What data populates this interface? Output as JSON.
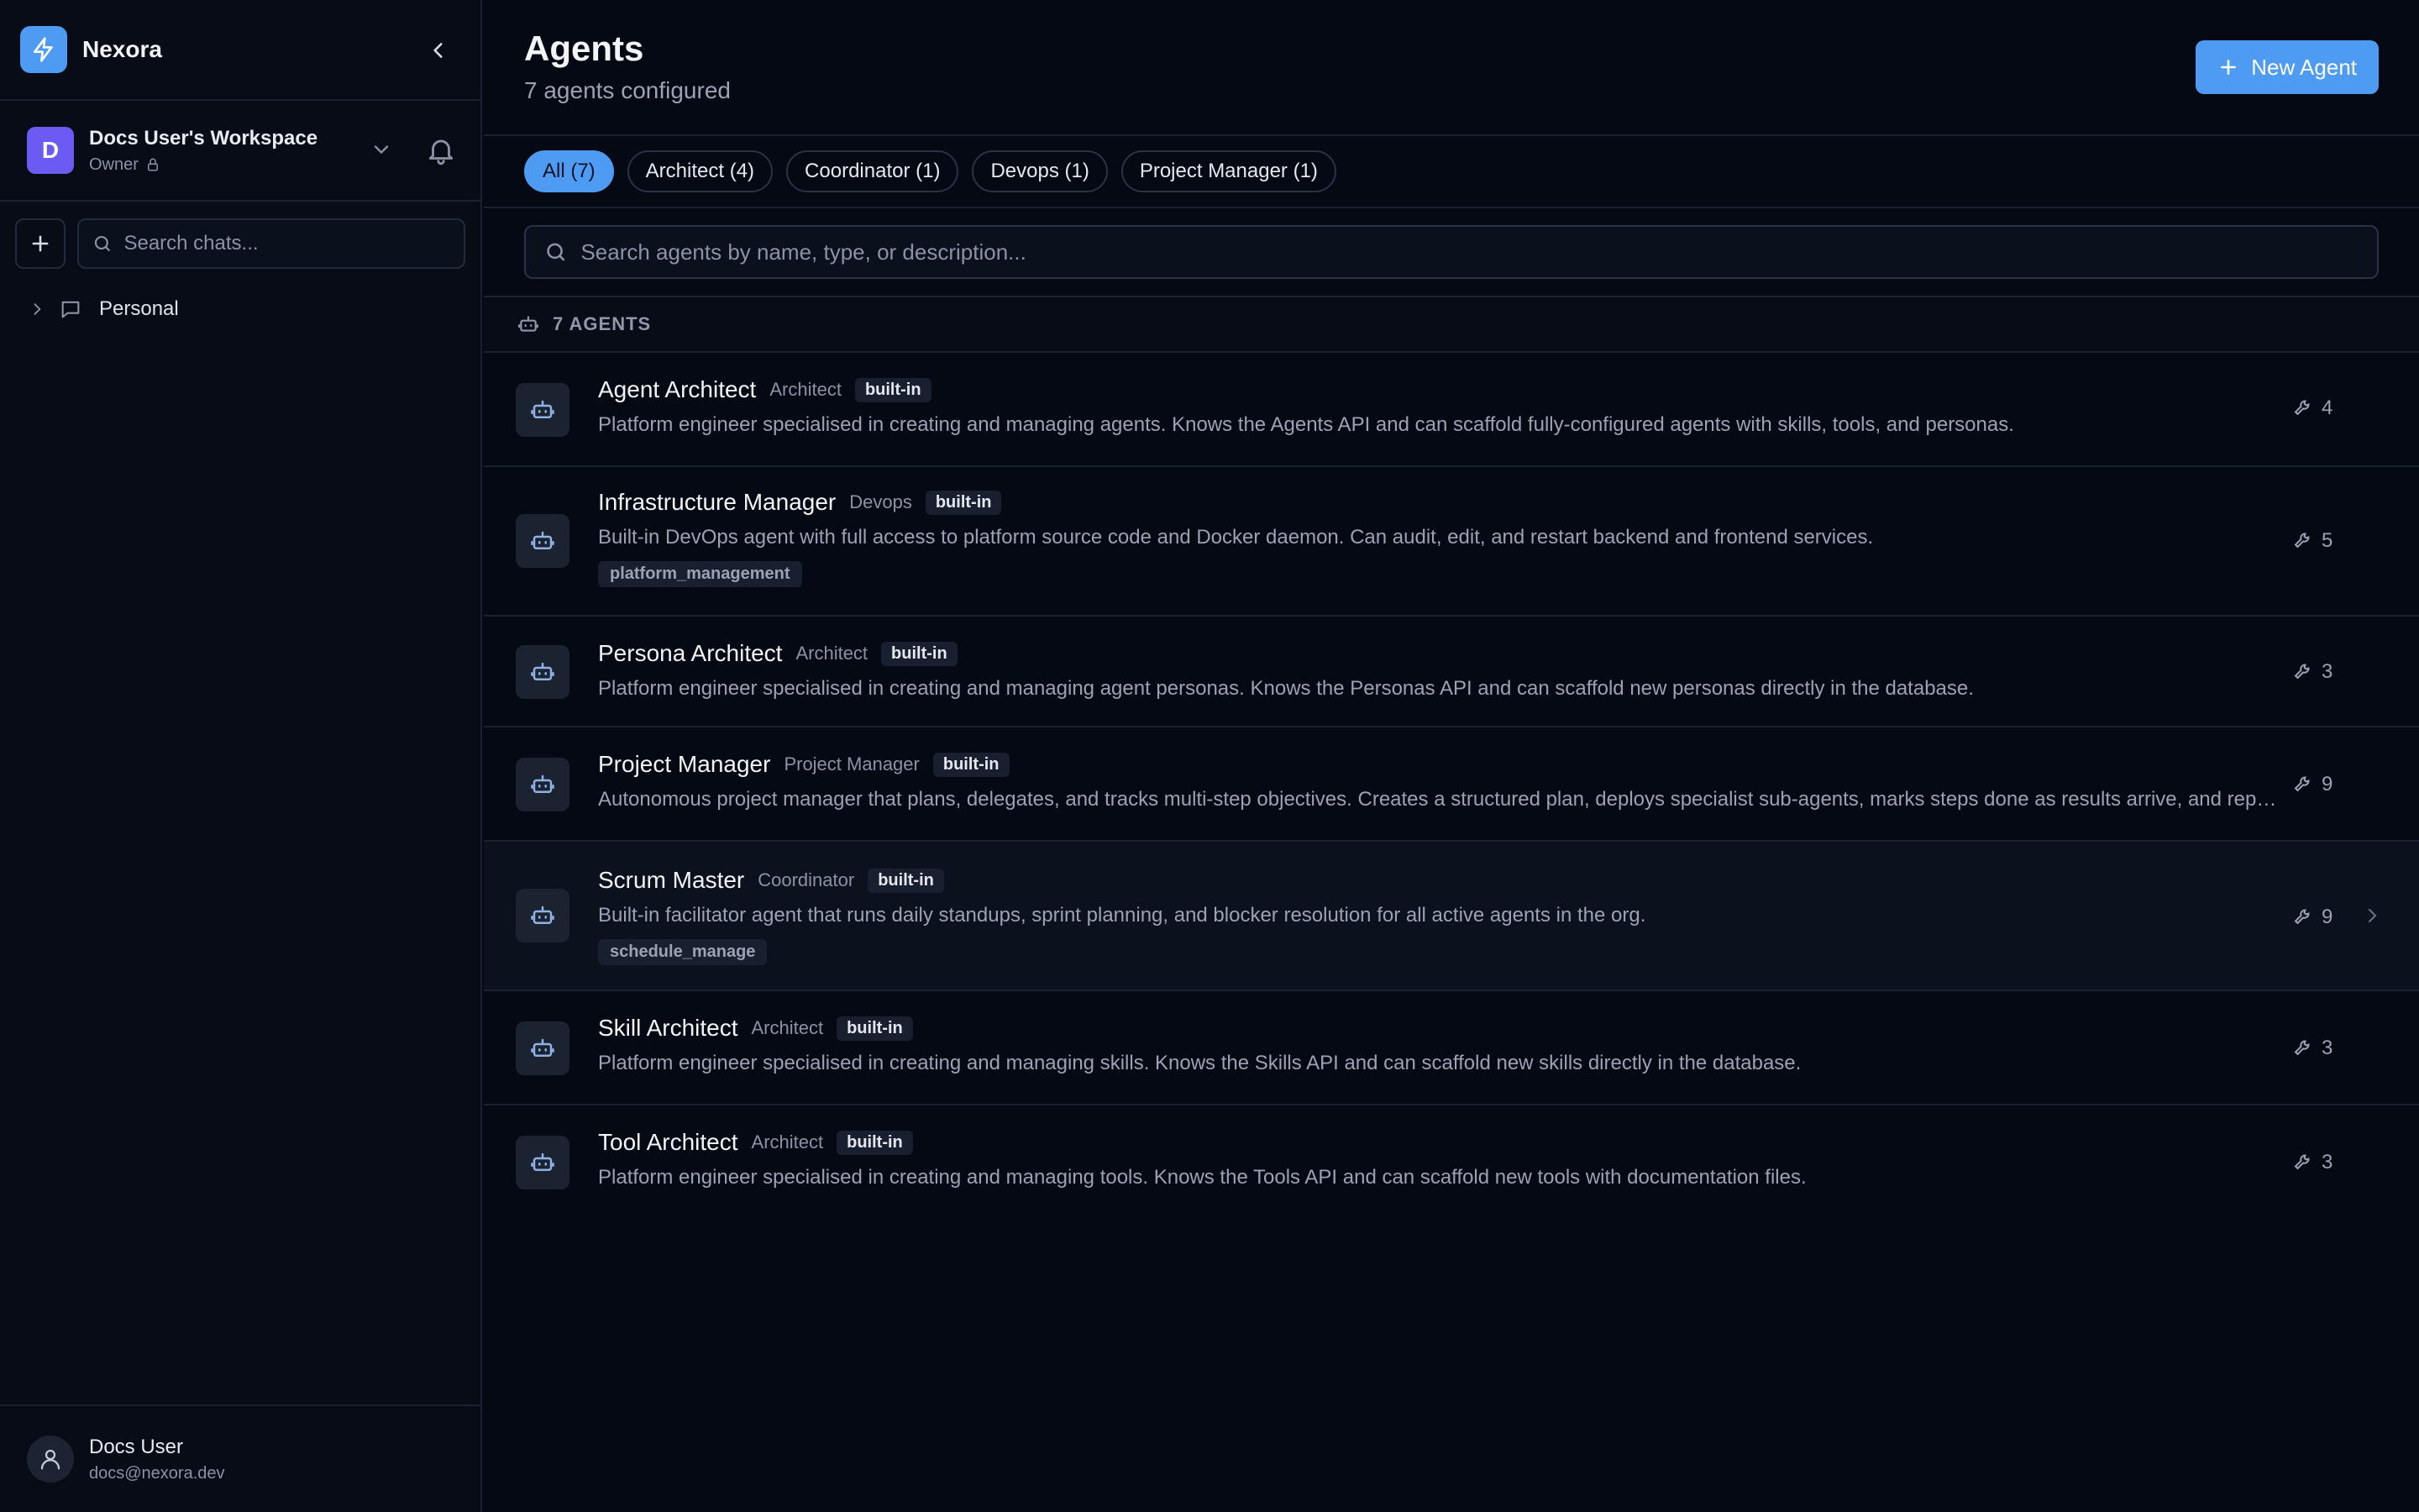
{
  "app": {
    "name": "Nexora"
  },
  "workspace": {
    "initial": "D",
    "name": "Docs User's Workspace",
    "role": "Owner"
  },
  "chat_search": {
    "placeholder": "Search chats..."
  },
  "folders": [
    {
      "label": "Personal"
    }
  ],
  "user": {
    "name": "Docs User",
    "email": "docs@nexora.dev"
  },
  "header": {
    "title": "Agents",
    "subtitle": "7 agents configured",
    "new_button": "New Agent"
  },
  "filters": [
    {
      "label": "All (7)",
      "active": true
    },
    {
      "label": "Architect (4)",
      "active": false
    },
    {
      "label": "Coordinator (1)",
      "active": false
    },
    {
      "label": "Devops (1)",
      "active": false
    },
    {
      "label": "Project Manager (1)",
      "active": false
    }
  ],
  "agent_search": {
    "placeholder": "Search agents by name, type, or description..."
  },
  "list": {
    "count_label": "7 AGENTS"
  },
  "agents": [
    {
      "name": "Agent Architect",
      "type": "Architect",
      "badge": "built-in",
      "description": "Platform engineer specialised in creating and managing agents. Knows the Agents API and can scaffold fully-configured agents with skills, tools, and personas.",
      "tag": "",
      "tools": "4"
    },
    {
      "name": "Infrastructure Manager",
      "type": "Devops",
      "badge": "built-in",
      "description": "Built-in DevOps agent with full access to platform source code and Docker daemon. Can audit, edit, and restart backend and frontend services.",
      "tag": "platform_management",
      "tools": "5"
    },
    {
      "name": "Persona Architect",
      "type": "Architect",
      "badge": "built-in",
      "description": "Platform engineer specialised in creating and managing agent personas. Knows the Personas API and can scaffold new personas directly in the database.",
      "tag": "",
      "tools": "3"
    },
    {
      "name": "Project Manager",
      "type": "Project Manager",
      "badge": "built-in",
      "description": "Autonomous project manager that plans, delegates, and tracks multi-step objectives. Creates a structured plan, deploys specialist sub-agents, marks steps done as results arrive, and reports progress.",
      "tag": "",
      "tools": "9"
    },
    {
      "name": "Scrum Master",
      "type": "Coordinator",
      "badge": "built-in",
      "description": "Built-in facilitator agent that runs daily standups, sprint planning, and blocker resolution for all active agents in the org.",
      "tag": "schedule_manage",
      "tools": "9"
    },
    {
      "name": "Skill Architect",
      "type": "Architect",
      "badge": "built-in",
      "description": "Platform engineer specialised in creating and managing skills. Knows the Skills API and can scaffold new skills directly in the database.",
      "tag": "",
      "tools": "3"
    },
    {
      "name": "Tool Architect",
      "type": "Architect",
      "badge": "built-in",
      "description": "Platform engineer specialised in creating and managing tools. Knows the Tools API and can scaffold new tools with documentation files.",
      "tag": "",
      "tools": "3"
    }
  ],
  "colors": {
    "accent": "#4d9bf2",
    "background": "#050913",
    "avatar": "#6a5cf2"
  }
}
